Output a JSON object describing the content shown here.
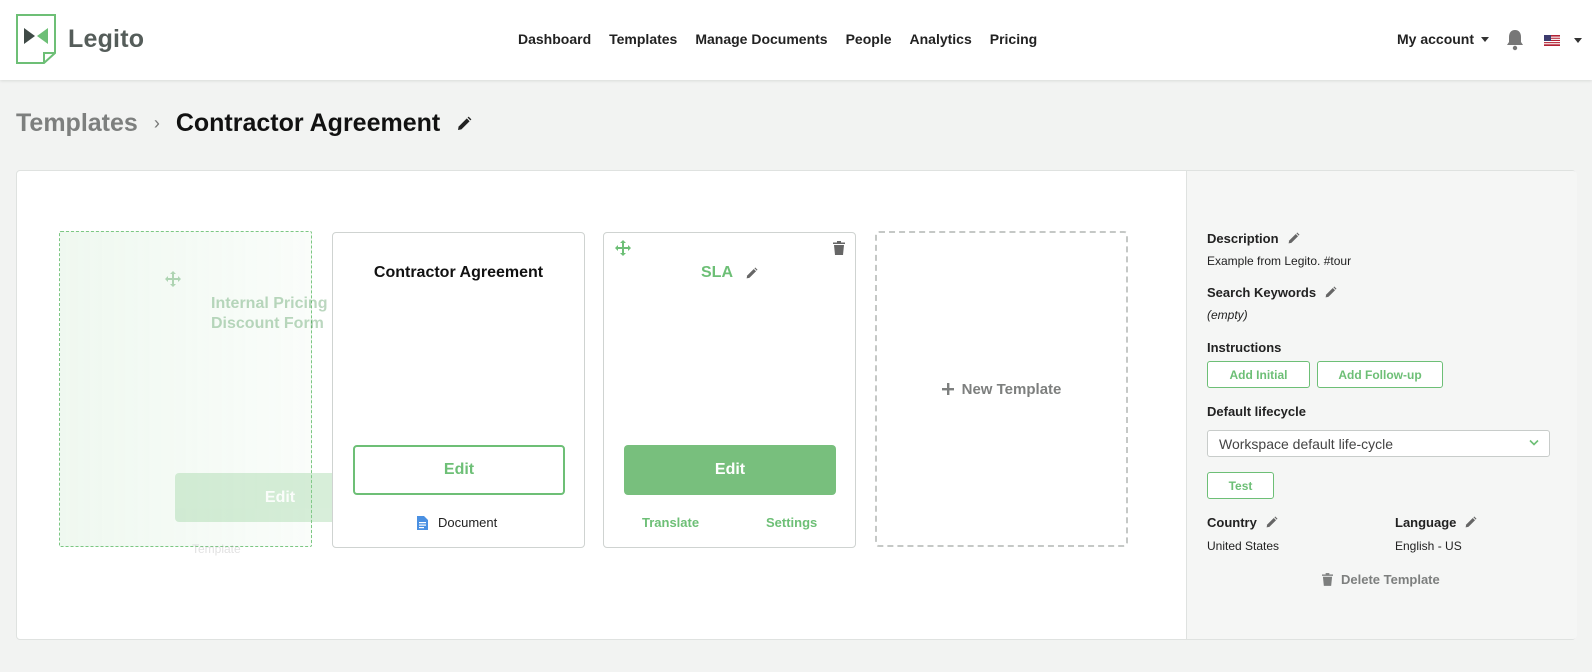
{
  "app": {
    "name": "Legito"
  },
  "nav": {
    "items": [
      "Dashboard",
      "Templates",
      "Manage Documents",
      "People",
      "Analytics",
      "Pricing"
    ],
    "account_label": "My account"
  },
  "breadcrumb": {
    "root": "Templates",
    "separator": "›",
    "current": "Contractor Agreement"
  },
  "cards": {
    "ghost": {
      "title_line1": "Internal Pricing &",
      "title_line2": "Discount Form",
      "edit": "Edit",
      "link": "Template"
    },
    "main": {
      "title": "Contractor Agreement",
      "edit": "Edit",
      "link": "Document"
    },
    "sla": {
      "title": "SLA",
      "edit": "Edit",
      "translate": "Translate",
      "settings": "Settings"
    },
    "new": {
      "label": "New Template"
    }
  },
  "sidebar": {
    "description_label": "Description",
    "description_value": "Example from Legito. #tour",
    "keywords_label": "Search Keywords",
    "keywords_value": "(empty)",
    "instructions_label": "Instructions",
    "add_initial": "Add Initial",
    "add_followup": "Add Follow-up",
    "lifecycle_label": "Default lifecycle",
    "lifecycle_value": "Workspace default life-cycle",
    "test": "Test",
    "country_label": "Country",
    "country_value": "United States",
    "language_label": "Language",
    "language_value": "English - US",
    "delete": "Delete Template"
  },
  "colors": {
    "accent": "#6dbf76",
    "accent_solid": "#78bf7d",
    "muted": "#7d7f7e"
  },
  "icons": [
    "legito-logo-icon",
    "bell-icon",
    "us-flag-icon",
    "pencil-icon",
    "move-icon",
    "trash-icon",
    "document-icon",
    "plus-icon",
    "chevron-down-icon"
  ]
}
